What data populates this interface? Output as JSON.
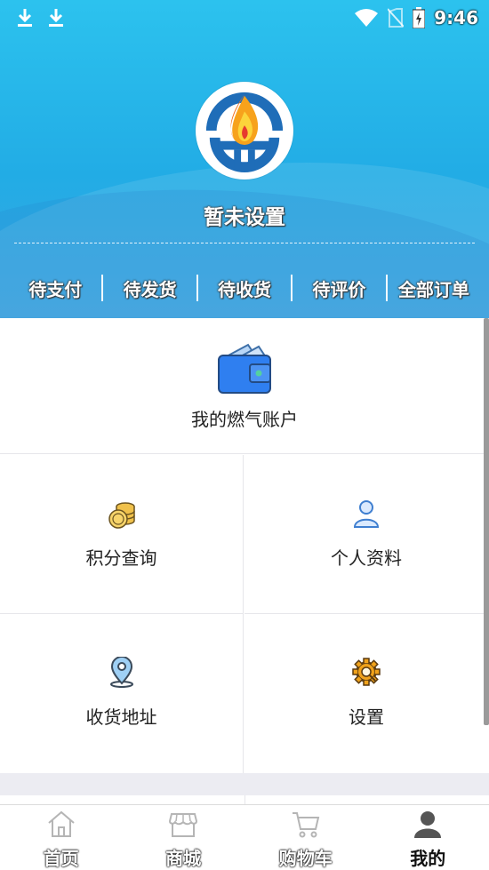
{
  "status_bar": {
    "time": "9:46",
    "icons": [
      "download-icon",
      "download-icon",
      "wifi-icon",
      "no-sim-icon",
      "battery-charging-icon"
    ]
  },
  "profile": {
    "nickname": "暂未设置",
    "avatar": "flame-logo-icon"
  },
  "orders": [
    "待支付",
    "待发货",
    "待收货",
    "待评价",
    "全部订单"
  ],
  "gas_account": {
    "label": "我的燃气账户",
    "icon": "wallet-icon"
  },
  "menu": [
    {
      "label": "积分查询",
      "icon": "coins-icon"
    },
    {
      "label": "个人资料",
      "icon": "person-icon"
    },
    {
      "label": "收货地址",
      "icon": "location-pin-icon"
    },
    {
      "label": "设置",
      "icon": "gear-icon"
    }
  ],
  "tabbar": [
    {
      "label": "首页",
      "icon": "home-icon",
      "active": false
    },
    {
      "label": "商城",
      "icon": "store-icon",
      "active": false
    },
    {
      "label": "购物车",
      "icon": "cart-icon",
      "active": false
    },
    {
      "label": "我的",
      "icon": "user-icon",
      "active": true
    }
  ],
  "colors": {
    "header_start": "#2cc2ee",
    "header_end": "#22ace5",
    "wallet_blue": "#2f7ff0",
    "coins_gold": "#f0c14b",
    "gear_orange": "#f0a21b"
  }
}
